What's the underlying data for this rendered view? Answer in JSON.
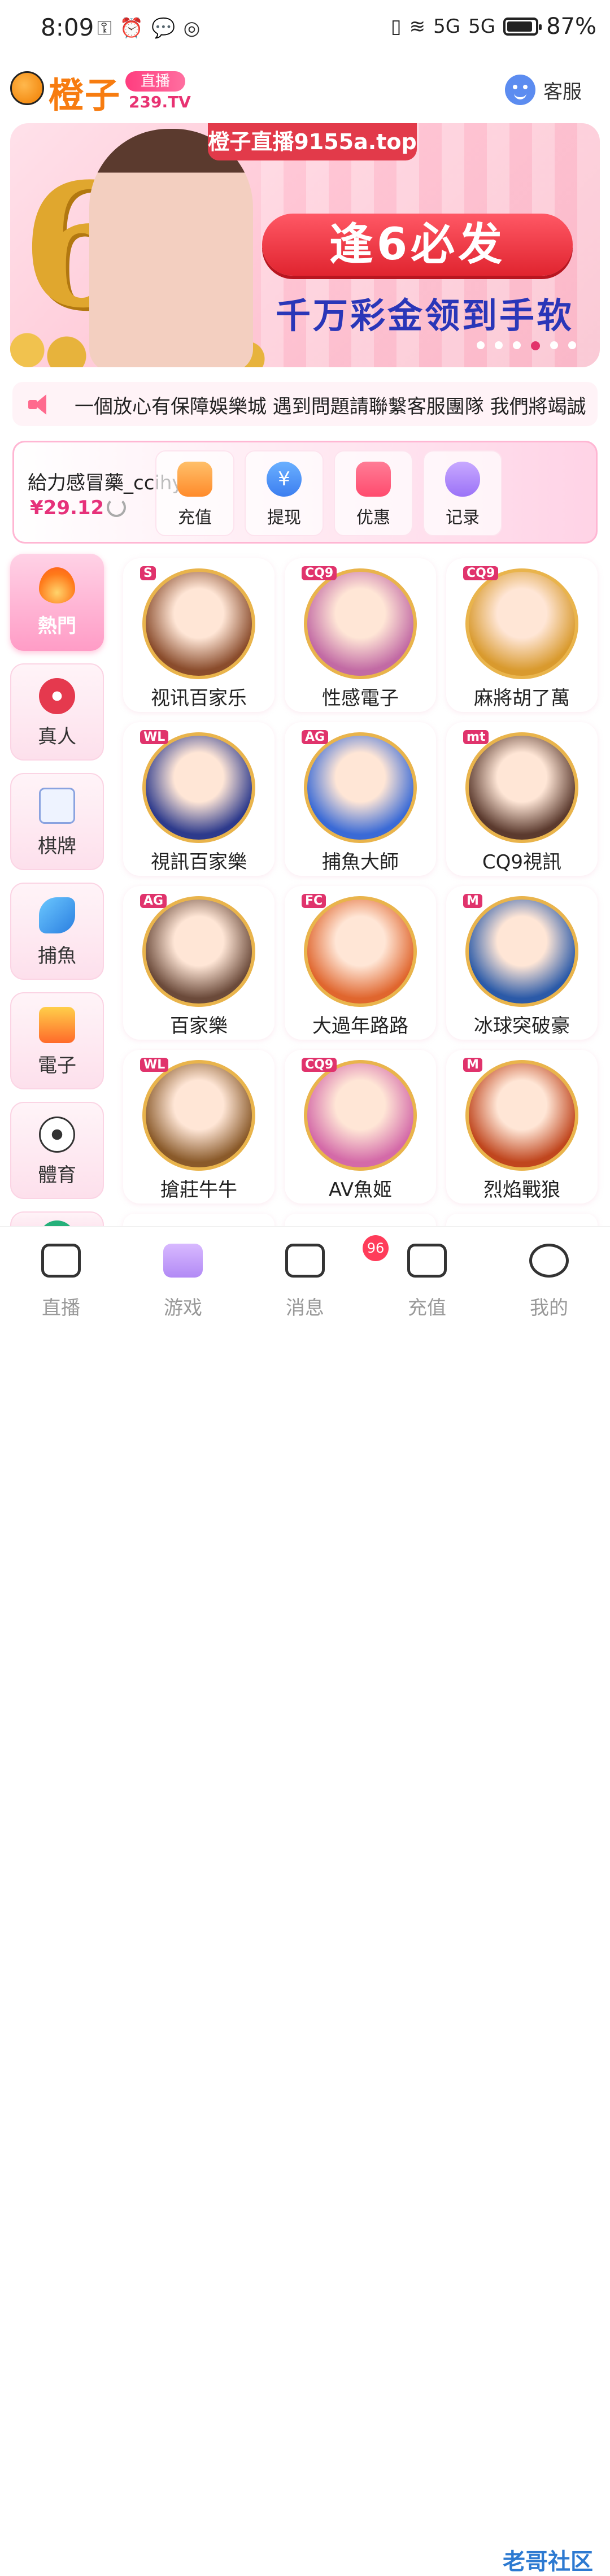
{
  "status": {
    "time": "8:09",
    "battery": "87%",
    "signal1": "5G",
    "signal2": "5G"
  },
  "header": {
    "brand": "橙子",
    "badge": "直播",
    "site": "239.TV",
    "customer_service": "客服"
  },
  "banner": {
    "top_text": "橙子直播9155a.top",
    "big_number": "6",
    "button_text": "逢6必发",
    "subtitle": "千万彩金领到手软",
    "slide_count": 6,
    "active_slide": 4
  },
  "marquee": {
    "text": "一個放心有保障娛樂城  遇到問題請聯繫客服團隊 我們將竭誠"
  },
  "account": {
    "username": "給力感冒藥_ccihyx",
    "balance": "¥29.12",
    "actions": [
      "充值",
      "提现",
      "优惠",
      "记录"
    ]
  },
  "categories": [
    "熱門",
    "真人",
    "棋牌",
    "捕魚",
    "電子",
    "體育"
  ],
  "games": [
    {
      "name": "视讯百家乐",
      "tag": "S",
      "color": "#8a4c2c"
    },
    {
      "name": "性感電子",
      "tag": "CQ9",
      "color": "#c26aa4"
    },
    {
      "name": "麻將胡了萬",
      "tag": "CQ9",
      "color": "#d99a2e"
    },
    {
      "name": "視訊百家樂",
      "tag": "WL",
      "color": "#2d3a8c"
    },
    {
      "name": "捕魚大師",
      "tag": "AG",
      "color": "#3a6ad6"
    },
    {
      "name": "CQ9視訊",
      "tag": "mt",
      "color": "#5b3a2e"
    },
    {
      "name": "百家樂",
      "tag": "AG",
      "color": "#6b4a3a"
    },
    {
      "name": "大過年路路",
      "tag": "FC",
      "color": "#e0662e"
    },
    {
      "name": "冰球突破豪",
      "tag": "M",
      "color": "#2b5aa8"
    },
    {
      "name": "搶莊牛牛",
      "tag": "WL",
      "color": "#8a5a2a"
    },
    {
      "name": "AV魚姬",
      "tag": "CQ9",
      "color": "#d46aa8"
    },
    {
      "name": "烈焰戰狼",
      "tag": "M",
      "color": "#c0461e"
    }
  ],
  "tabs": [
    {
      "label": "直播",
      "icon": "camera-icon"
    },
    {
      "label": "游戏",
      "icon": "gamepad-icon"
    },
    {
      "label": "消息",
      "icon": "message-icon",
      "badge": "96"
    },
    {
      "label": "充值",
      "icon": "wallet-icon"
    },
    {
      "label": "我的",
      "icon": "smile-icon"
    }
  ]
}
